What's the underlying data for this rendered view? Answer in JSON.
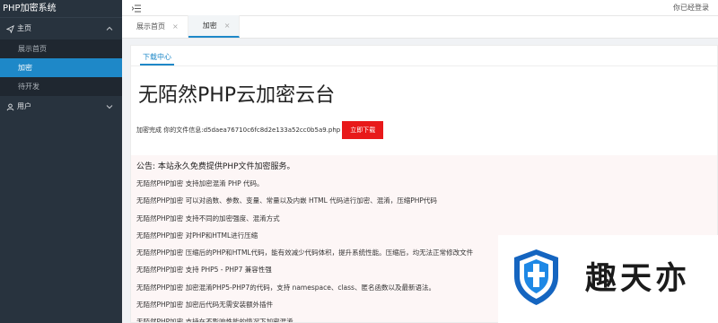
{
  "app": {
    "title": "PHP加密系统"
  },
  "sidebar": {
    "groups": [
      {
        "label": "主页",
        "icon": "paper-plane-icon",
        "expanded": true,
        "items": [
          {
            "label": "展示首页",
            "active": false
          },
          {
            "label": "加密",
            "active": true
          },
          {
            "label": "待开发",
            "active": false
          }
        ]
      },
      {
        "label": "用户",
        "icon": "user-icon",
        "expanded": false,
        "items": []
      }
    ]
  },
  "topbar": {
    "user_label": "你已经登录"
  },
  "tabs": [
    {
      "label": "展示首页",
      "active": false,
      "close": "×"
    },
    {
      "label": "加密",
      "active": true,
      "close": "×"
    }
  ],
  "card": {
    "tab_label": "下载中心",
    "title": "无陌然PHP云加密云台",
    "info_text": "加密完成 你的文件信息:d5daea76710c6fc8d2e133a52cc0b5a9.php",
    "download_button": "立即下载"
  },
  "notice": {
    "title": "公告: 本站永久免费提供PHP文件加密服务。",
    "lines": [
      "无陌然PHP加密 支持加密混淆 PHP 代码。",
      "无陌然PHP加密 可以对函数、参数、变量、常量以及内嵌 HTML 代码进行加密、混淆，压缩PHP代码",
      "无陌然PHP加密 支持不同的加密强度、混淆方式",
      "无陌然PHP加密 对PHP和HTML进行压缩",
      "无陌然PHP加密 压缩后的PHP和HTML代码，能有效减少代码体积，提升系统性能。压缩后，均无法正常修改文件",
      "无陌然PHP加密 支持 PHP5 - PHP7 兼容性强",
      "无陌然PHP加密 加密混淆PHP5-PHP7的代码，支持 namespace、class、匿名函数以及最新语法。",
      "无陌然PHP加密 加密后代码无需安装额外插件",
      "无陌然PHP加密 支持在不影响性能的情况下加密混淆"
    ]
  },
  "watermark": {
    "text": "趣天亦"
  },
  "colors": {
    "sidebar_bg": "#28333e",
    "accent": "#1e88c8",
    "download_button": "#e8191a",
    "notice_bg": "#fdf6f6"
  }
}
